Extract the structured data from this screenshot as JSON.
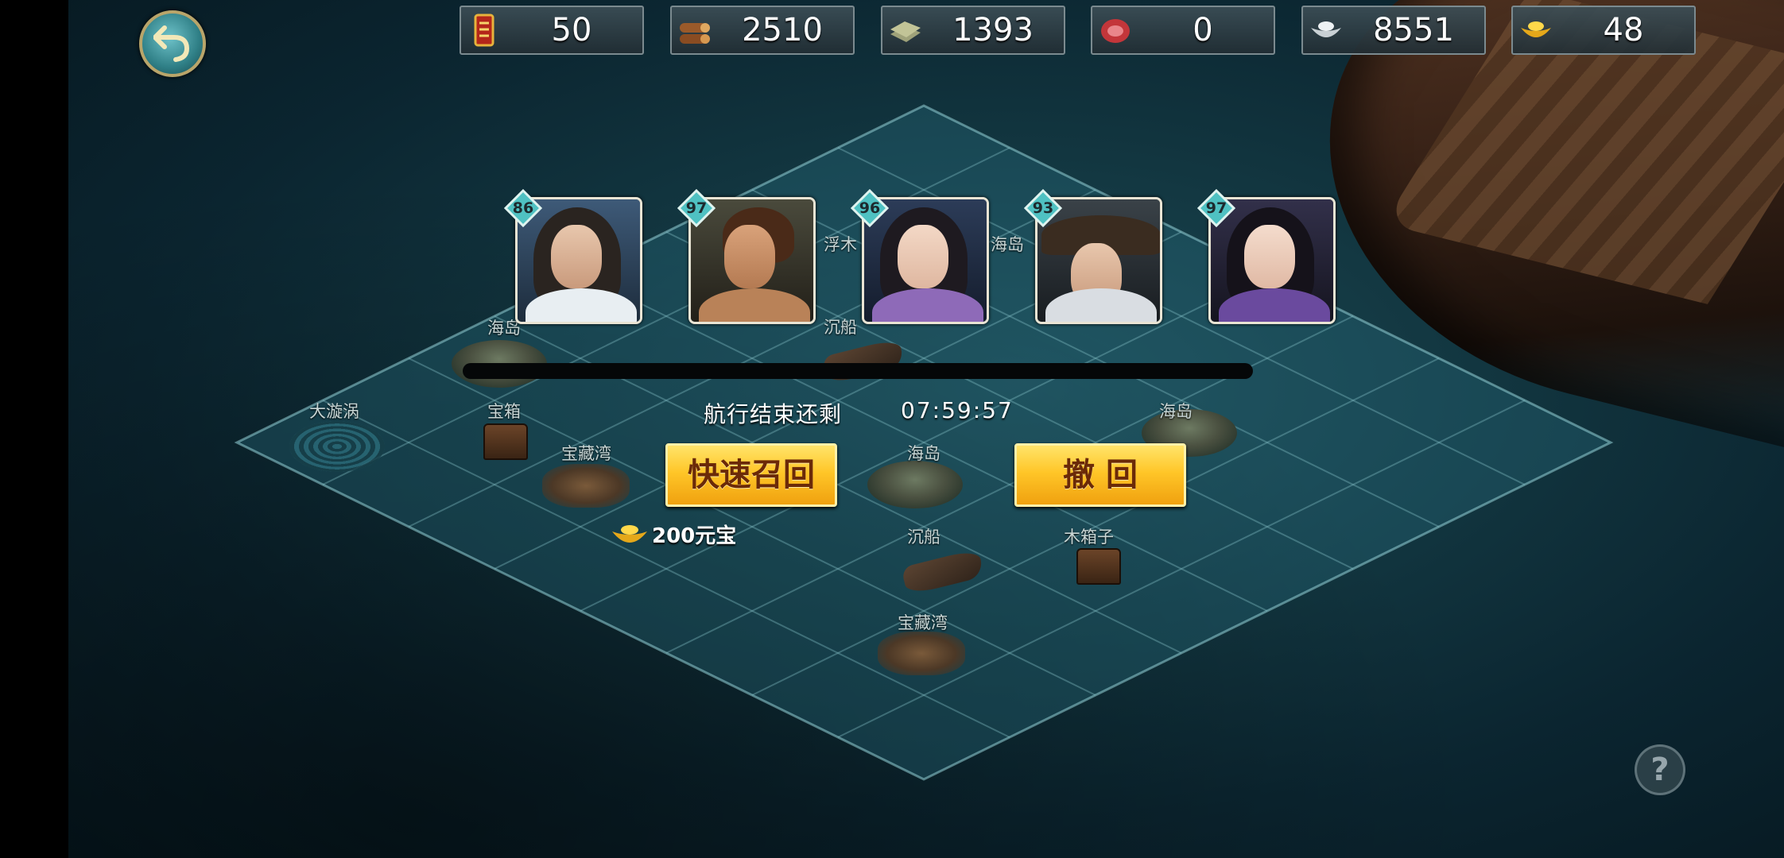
{
  "resources": [
    {
      "icon": "command-token-icon",
      "value": "50"
    },
    {
      "icon": "wood-logs-icon",
      "value": "2510"
    },
    {
      "icon": "stone-slab-icon",
      "value": "1393"
    },
    {
      "icon": "meat-food-icon",
      "value": "0"
    },
    {
      "icon": "silver-ingot-icon",
      "value": "8551"
    },
    {
      "icon": "gold-ingot-icon",
      "value": "48"
    }
  ],
  "heroes": [
    {
      "level": "86"
    },
    {
      "level": "97"
    },
    {
      "level": "96"
    },
    {
      "level": "93"
    },
    {
      "level": "97"
    }
  ],
  "voyage": {
    "remaining_label": "航行结束还剩",
    "remaining_time": "07:59:57",
    "progress": 0.0
  },
  "buttons": {
    "quick_recall": "快速召回",
    "withdraw": "撤 回",
    "quick_recall_cost": "200元宝"
  },
  "map_labels": {
    "whirlpool": "大漩涡",
    "treasure_box_1": "宝箱",
    "treasure_cove_1": "宝藏湾",
    "island_1": "海岛",
    "driftwood": "浮木",
    "island_2": "海岛",
    "shipwreck_1": "沉船",
    "island_3": "海岛",
    "island_4": "海岛",
    "shipwreck_2": "沉船",
    "wooden_box": "木箱子",
    "treasure_cove_2": "宝藏湾"
  },
  "help": "?"
}
